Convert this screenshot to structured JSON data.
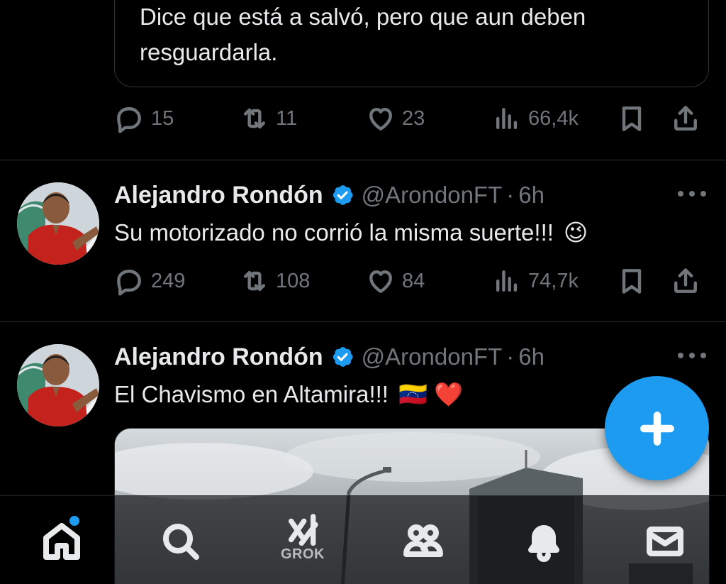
{
  "quoted_card": {
    "text": "Dice que está a salvó, pero que aun deben resguardarla."
  },
  "first_tweet_actions": {
    "replies": "15",
    "reposts": "11",
    "likes": "23",
    "views": "66,4k"
  },
  "tweets": [
    {
      "author_name": "Alejandro Rondón",
      "handle": "@ArondonFT",
      "separator": "·",
      "time": "6h",
      "text": "Su motorizado no corrió la misma suerte!!!",
      "emoji": "😉",
      "actions": {
        "replies": "249",
        "reposts": "108",
        "likes": "84",
        "views": "74,7k"
      }
    },
    {
      "author_name": "Alejandro Rondón",
      "handle": "@ArondonFT",
      "separator": "·",
      "time": "6h",
      "text": "El Chavismo en Altamira!!!",
      "emoji": "🇻🇪 ❤️"
    }
  ],
  "bottom_nav": {
    "grok_label": "GROK",
    "items": [
      "home-icon",
      "search-icon",
      "grok-icon",
      "communities-icon",
      "notifications-icon",
      "messages-icon"
    ]
  },
  "colors": {
    "background": "#000000",
    "accent": "#1d9bf0",
    "muted": "#71767b",
    "text": "#e7e9ea",
    "divider": "#2f3336"
  }
}
